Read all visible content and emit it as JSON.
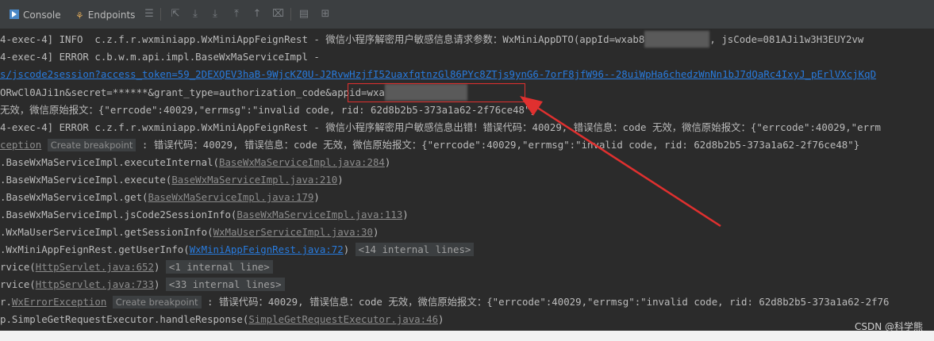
{
  "toolbar": {
    "tabs": [
      {
        "label": "Console",
        "icon": "console-icon"
      },
      {
        "label": "Endpoints",
        "icon": "endpoints-icon"
      }
    ],
    "icons": [
      "menu-icon",
      "scroll-up-icon",
      "download-icon",
      "download-alt-icon",
      "upload-icon",
      "up-arrow-icon",
      "clear-icon",
      "print-icon",
      "layout-icon"
    ]
  },
  "console": {
    "line1": {
      "text_a": "4-exec-4] INFO  c.z.f.r.wxminiapp.WxMiniAppFeignRest - 微信小程序解密用户敏感信息请求参数：WxMiniAppDTO(appId=wxab8",
      "text_b": ", jsCode=081AJi1w3H3EUY2vw"
    },
    "line2": "4-exec-4] ERROR c.b.w.m.api.impl.BaseWxMaServiceImpl -",
    "line3": "s/jscode2session?access_token=59_2DEXQEV3haB-9WjcKZ0U-J2RvwHzjfI52uaxfqtnzGl86PYc8ZTjs9ynG6-7orF8jfW96--28uiWpHa6chedzWnNn1bJ7dQaRc4IxyJ_pErlVXcjKqD",
    "line4": {
      "text_a": "ORwCl0AJi1n&secret=******&grant_type=authorization_code",
      "text_b": "&appid=wxa"
    },
    "line5": "无效，微信原始报文：{\"errcode\":40029,\"errmsg\":\"invalid code, rid: 62d8b2b5-373a1a62-2f76ce48\"}",
    "line6": "4-exec-4] ERROR c.z.f.r.wxminiapp.WxMiniAppFeignRest - 微信小程序解密用户敏感信息出错！错误代码：40029, 错误信息：code 无效，微信原始报文：{\"errcode\":40029,\"errm",
    "line7": {
      "link": "ception",
      "badge": "Create breakpoint",
      "text": " : 错误代码：40029, 错误信息：code 无效，微信原始报文：{\"errcode\":40029,\"errmsg\":\"invalid code, rid: 62d8b2b5-373a1a62-2f76ce48\"}"
    },
    "line8": {
      "text": ".BaseWxMaServiceImpl.executeInternal(",
      "link": "BaseWxMaServiceImpl.java:284",
      "end": ")"
    },
    "line9": {
      "text": ".BaseWxMaServiceImpl.execute(",
      "link": "BaseWxMaServiceImpl.java:210",
      "end": ")"
    },
    "line10": {
      "text": ".BaseWxMaServiceImpl.get(",
      "link": "BaseWxMaServiceImpl.java:179",
      "end": ")"
    },
    "line11": {
      "text": ".BaseWxMaServiceImpl.jsCode2SessionInfo(",
      "link": "BaseWxMaServiceImpl.java:113",
      "end": ")"
    },
    "line12": {
      "text": ".WxMaUserServiceImpl.getSessionInfo(",
      "link": "WxMaUserServiceImpl.java:30",
      "end": ")"
    },
    "line13": {
      "text": ".WxMiniAppFeignRest.getUserInfo(",
      "link": "WxMiniAppFeignRest.java:72",
      "end": ")",
      "internal": "<14 internal lines>"
    },
    "line14": {
      "text": "rvice(",
      "link": "HttpServlet.java:652",
      "end": ")",
      "internal": "<1 internal line>"
    },
    "line15": {
      "text": "rvice(",
      "link": "HttpServlet.java:733",
      "end": ")",
      "internal": "<33 internal lines>"
    },
    "line16": {
      "prefix": "r.",
      "link": "WxErrorException",
      "badge": "Create breakpoint",
      "text": " : 错误代码：40029, 错误信息：code 无效，微信原始报文：{\"errcode\":40029,\"errmsg\":\"invalid code, rid: 62d8b2b5-373a1a62-2f76"
    },
    "line17": {
      "text": "p.SimpleGetRequestExecutor.handleResponse(",
      "link": "SimpleGetRequestExecutor.java:46",
      "end": ")"
    }
  },
  "watermark": "CSDN @科学熊",
  "colors": {
    "background": "#2b2b2b",
    "link": "#287bde",
    "annotation_red": "#e0302f"
  }
}
